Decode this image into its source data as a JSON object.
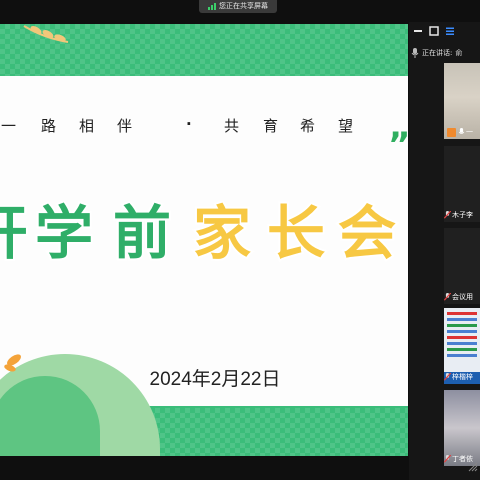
{
  "share_banner": {
    "text": "您正在共享屏幕",
    "accent": "#3ccf6a"
  },
  "slide": {
    "slogan_chars": [
      "一",
      "路",
      "相",
      "伴",
      "·",
      "共",
      "育",
      "希",
      "望"
    ],
    "quote_mark": "”",
    "title_green": [
      "开",
      "学",
      "前"
    ],
    "title_yellow": [
      "家",
      "长",
      "会"
    ],
    "date": "2024年2月22日",
    "colors": {
      "green": "#3bbd7a",
      "title_green": "#2fae68",
      "title_yellow": "#f7c843"
    }
  },
  "panel": {
    "controls": [
      "minimize-icon",
      "window-icon",
      "list-icon"
    ],
    "speaking_label": "正在讲话:",
    "speaking_name": "俞",
    "tiles": [
      {
        "label": "一"
      },
      {
        "label": "木子李"
      },
      {
        "label": "会议用"
      },
      {
        "label": "梓楷梓"
      },
      {
        "label": "丁者依"
      }
    ]
  }
}
